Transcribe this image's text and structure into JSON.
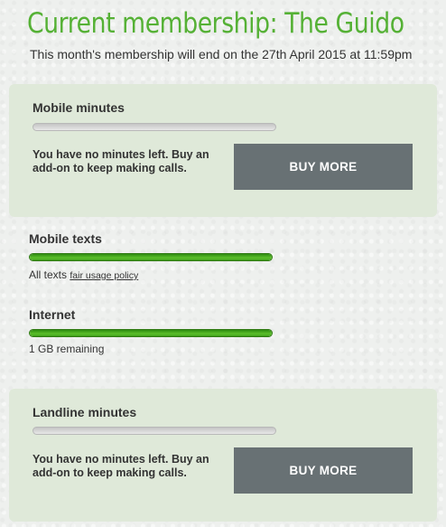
{
  "header": {
    "title": "Current membership: The Guido",
    "subtitle": "This month's membership will end on the 27th April 2015 at 11:59pm"
  },
  "mobile_minutes": {
    "label": "Mobile minutes",
    "remaining_fraction": 0,
    "message": "You have no minutes left. Buy an add-on to keep making calls.",
    "button_label": "BUY MORE"
  },
  "mobile_texts": {
    "label": "Mobile texts",
    "remaining_fraction": 1,
    "note_prefix": "All texts",
    "policy_link": "fair usage policy"
  },
  "internet": {
    "label": "Internet",
    "remaining_fraction": 1,
    "note": "1 GB remaining"
  },
  "landline_minutes": {
    "label": "Landline minutes",
    "remaining_fraction": 0,
    "message": "You have no minutes left. Buy an add-on to keep making calls.",
    "button_label": "BUY MORE"
  },
  "colors": {
    "title": "#55b135",
    "panel": "#dfe9d9",
    "button": "#687174",
    "bar_fill": "#3f9e1c"
  }
}
